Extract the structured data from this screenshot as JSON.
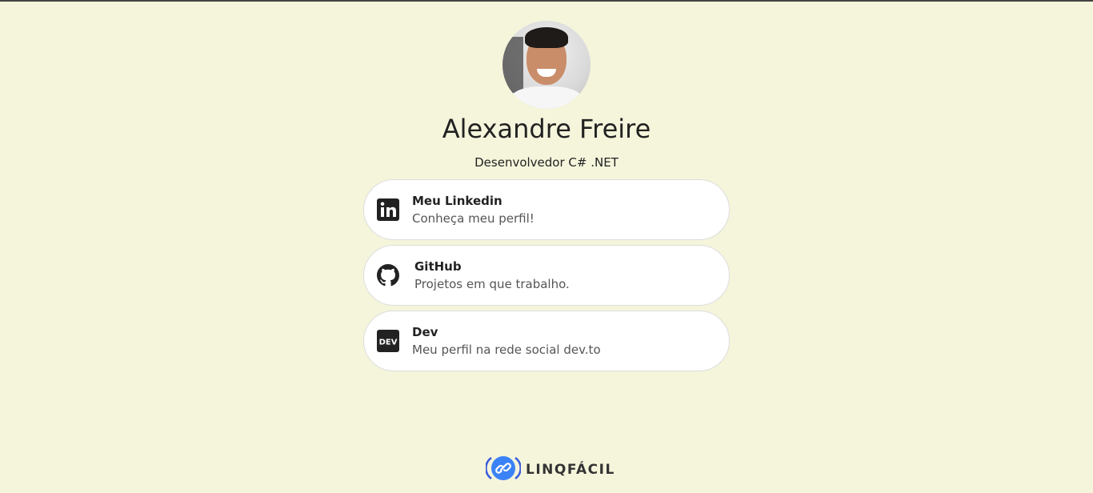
{
  "profile": {
    "name": "Alexandre Freire",
    "subtitle": "Desenvolvedor C# .NET"
  },
  "links": [
    {
      "icon": "linkedin-icon",
      "title": "Meu Linkedin",
      "description": "Conheça meu perfil!"
    },
    {
      "icon": "github-icon",
      "title": "GitHub",
      "description": "Projetos em que trabalho."
    },
    {
      "icon": "dev-icon",
      "title": "Dev",
      "description": "Meu perfil na rede social dev.to"
    }
  ],
  "footer": {
    "brand": "LINQFÁCIL",
    "brand_color": "#3b82f6"
  },
  "colors": {
    "background": "#f5f5dc",
    "card": "#ffffff"
  }
}
